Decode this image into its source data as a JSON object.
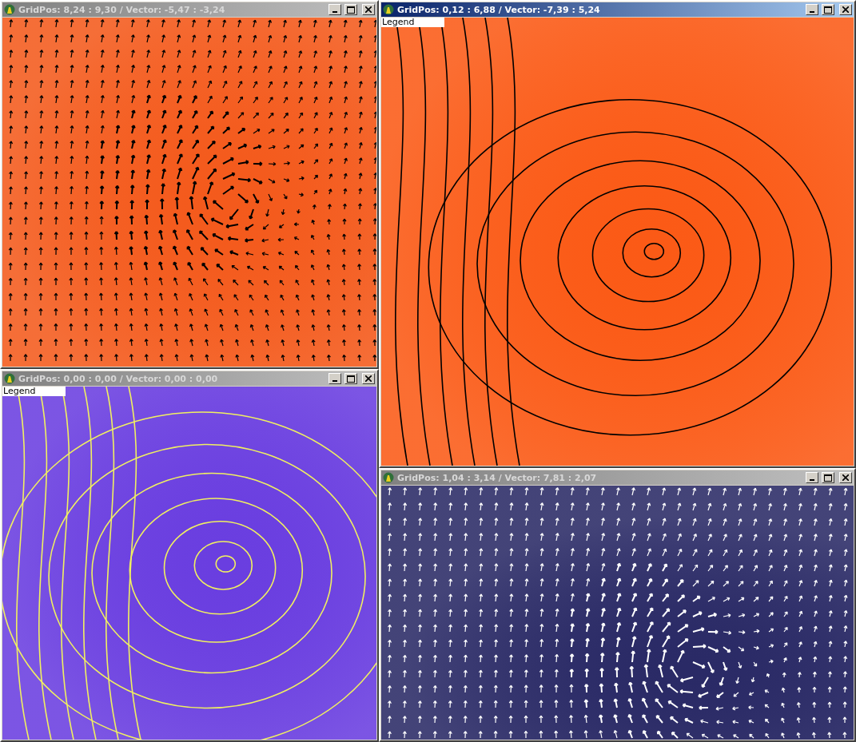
{
  "windows": [
    {
      "title": "GridPos: 8,24 : 9,30 / Vector: -5,47 : -3,24",
      "active": false,
      "kind": "arrows",
      "color": "#f45a1c"
    },
    {
      "title": "GridPos: 0,00 : 0,00 / Vector: 0,00 : 0,00",
      "active": false,
      "kind": "streamlines",
      "legend": "Legend",
      "color": "#6a3ee0"
    },
    {
      "title": "GridPos: 0,12 : 6,88 / Vector: -7,39 : 5,24",
      "active": true,
      "kind": "streamlines",
      "legend": "Legend",
      "color": "#fb5a16"
    },
    {
      "title": "GridPos: 1,04 : 3,14 / Vector: 7,81 : 2,07",
      "active": false,
      "kind": "arrows",
      "color": "#2a2a66"
    }
  ]
}
